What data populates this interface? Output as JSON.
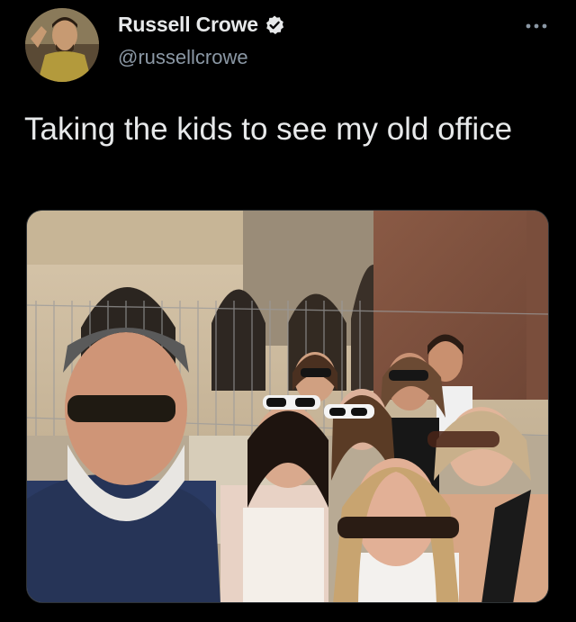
{
  "author": {
    "display_name": "Russell Crowe",
    "handle": "@russellcrowe",
    "verified": true,
    "avatar_icon": "profile-avatar",
    "verified_icon": "verified-badge-icon"
  },
  "tweet": {
    "text": "Taking the kids to see my old office"
  },
  "media": {
    "type": "photo",
    "description_icon": "group-selfie-photo"
  },
  "menu": {
    "icon": "more-options-icon"
  },
  "colors": {
    "background": "#000000",
    "text_primary": "#e7e9ea",
    "text_secondary": "#8b98a5",
    "verified_badge": "#e7e9ea"
  }
}
